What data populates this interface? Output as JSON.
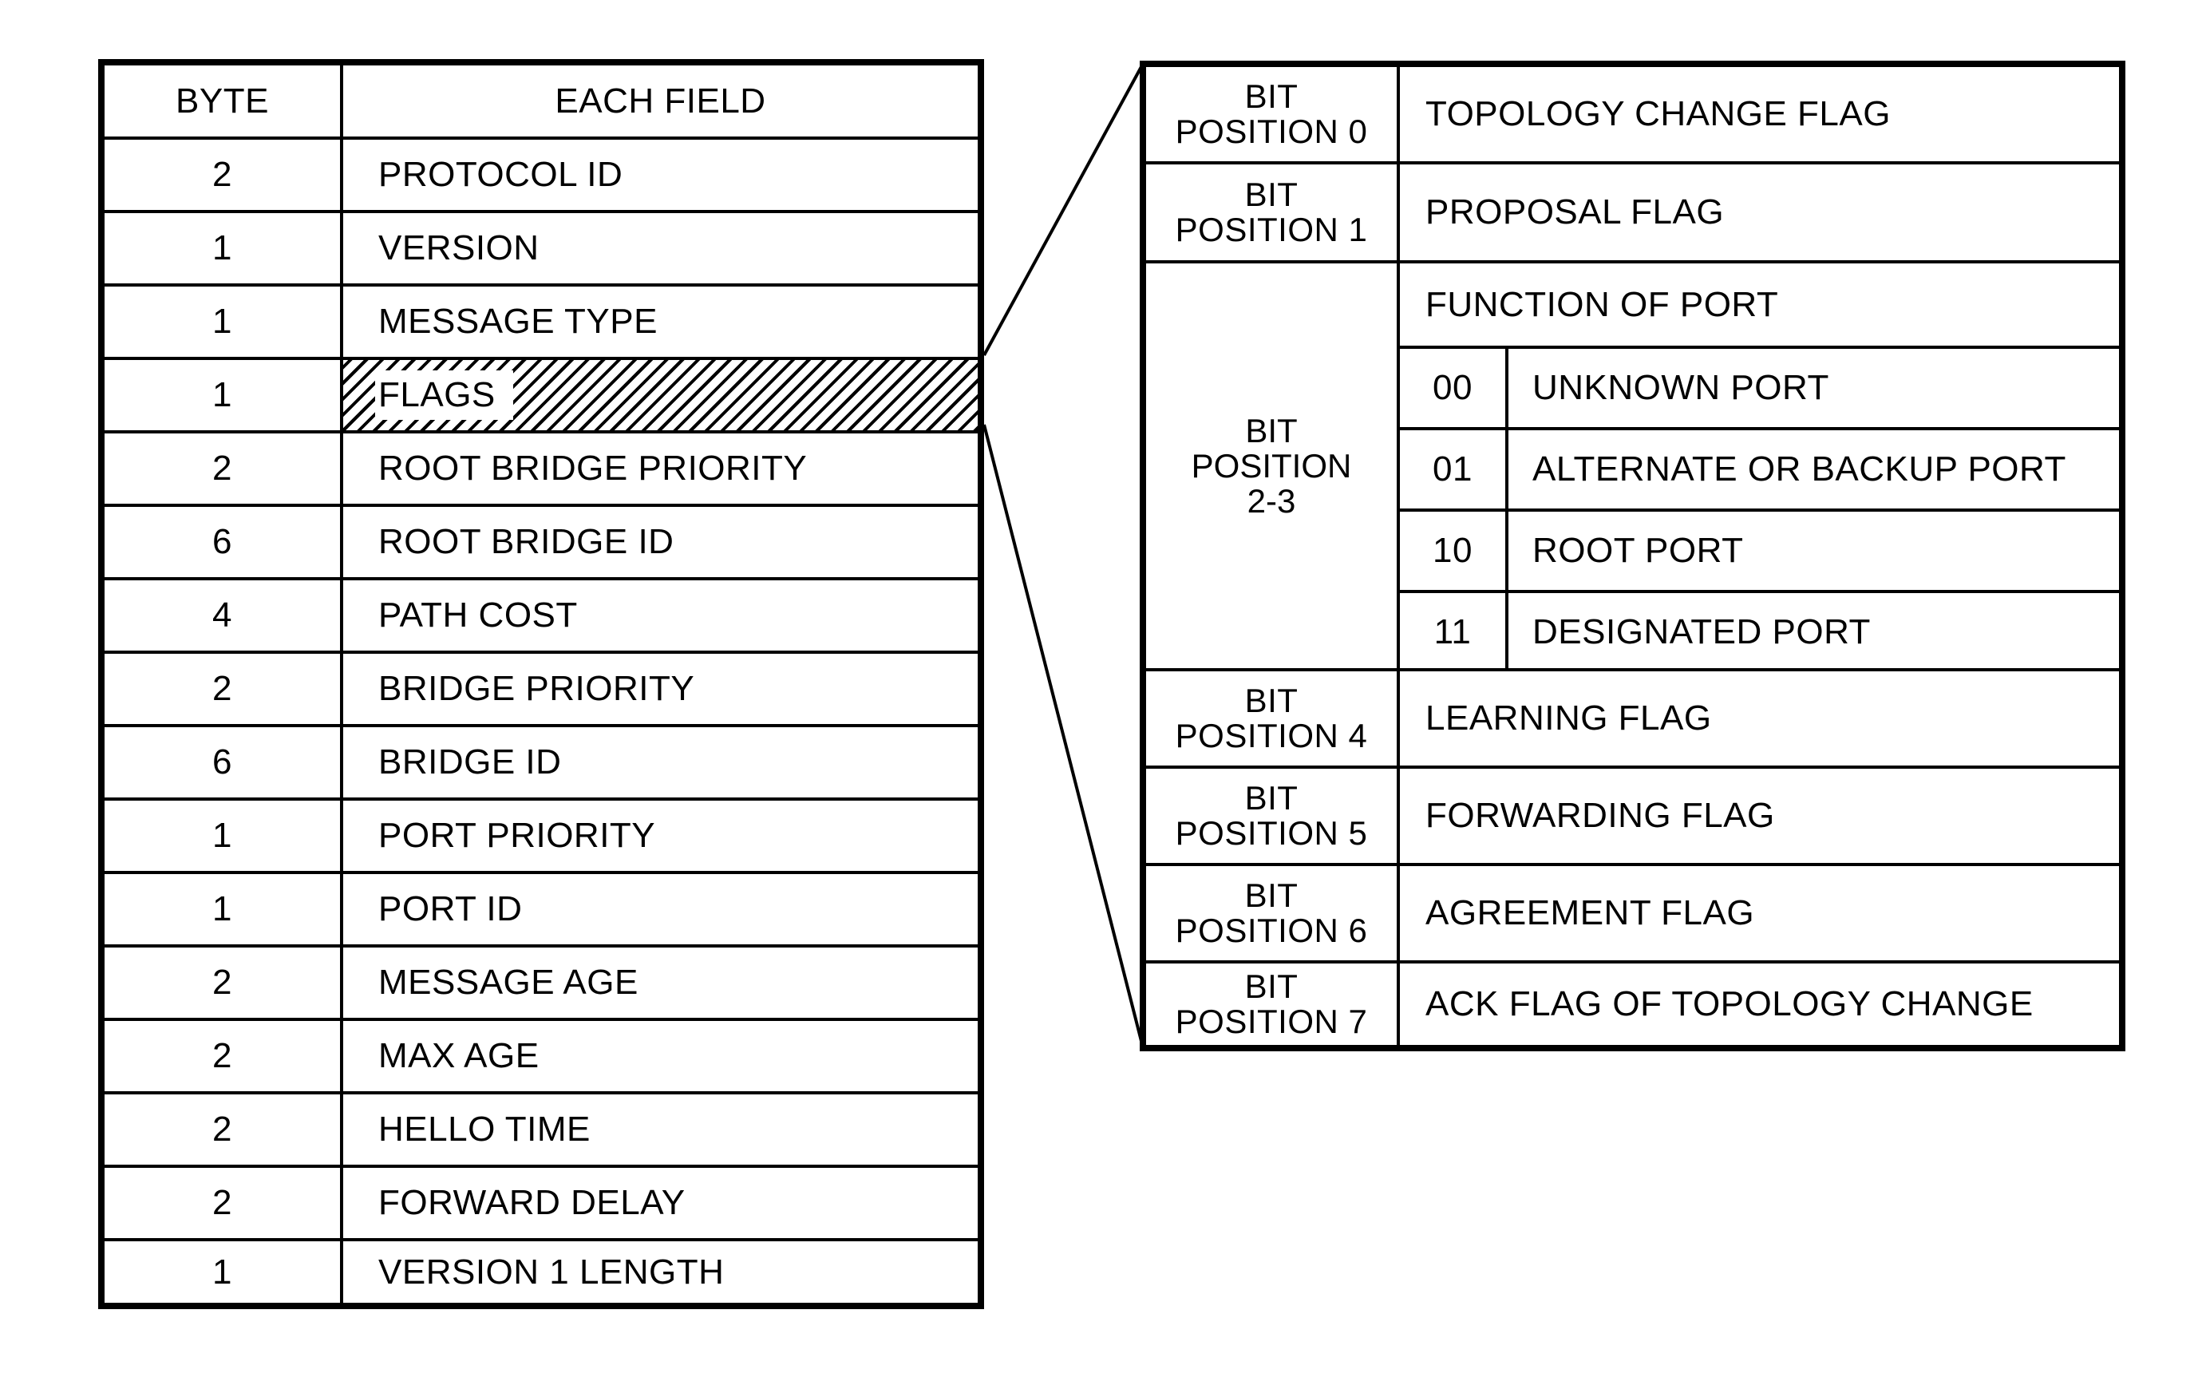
{
  "left_table": {
    "headers": {
      "byte": "BYTE",
      "field": "EACH FIELD"
    },
    "rows": [
      {
        "byte": "2",
        "field": "PROTOCOL ID"
      },
      {
        "byte": "1",
        "field": "VERSION"
      },
      {
        "byte": "1",
        "field": "MESSAGE TYPE"
      },
      {
        "byte": "1",
        "field": "FLAGS",
        "highlighted": true
      },
      {
        "byte": "2",
        "field": "ROOT BRIDGE PRIORITY"
      },
      {
        "byte": "6",
        "field": "ROOT BRIDGE ID"
      },
      {
        "byte": "4",
        "field": "PATH COST"
      },
      {
        "byte": "2",
        "field": "BRIDGE PRIORITY"
      },
      {
        "byte": "6",
        "field": "BRIDGE ID"
      },
      {
        "byte": "1",
        "field": "PORT PRIORITY"
      },
      {
        "byte": "1",
        "field": "PORT ID"
      },
      {
        "byte": "2",
        "field": "MESSAGE AGE"
      },
      {
        "byte": "2",
        "field": "MAX AGE"
      },
      {
        "byte": "2",
        "field": "HELLO TIME"
      },
      {
        "byte": "2",
        "field": "FORWARD DELAY"
      },
      {
        "byte": "1",
        "field": "VERSION 1 LENGTH"
      }
    ]
  },
  "right_table": {
    "bits": [
      {
        "line1": "BIT",
        "line2": "POSITION 0",
        "desc": "TOPOLOGY CHANGE FLAG"
      },
      {
        "line1": "BIT",
        "line2": "POSITION 1",
        "desc": "PROPOSAL FLAG"
      },
      {
        "line1": "BIT",
        "line2": "POSITION",
        "line3": "2-3",
        "desc": "FUNCTION OF PORT",
        "codes": [
          {
            "code": "00",
            "desc": "UNKNOWN PORT"
          },
          {
            "code": "01",
            "desc": "ALTERNATE OR BACKUP PORT"
          },
          {
            "code": "10",
            "desc": "ROOT PORT"
          },
          {
            "code": "11",
            "desc": "DESIGNATED PORT"
          }
        ]
      },
      {
        "line1": "BIT",
        "line2": "POSITION 4",
        "desc": "LEARNING FLAG"
      },
      {
        "line1": "BIT",
        "line2": "POSITION 5",
        "desc": "FORWARDING FLAG"
      },
      {
        "line1": "BIT",
        "line2": "POSITION 6",
        "desc": "AGREEMENT FLAG"
      },
      {
        "line1": "BIT",
        "line2": "POSITION 7",
        "desc": "ACK FLAG OF TOPOLOGY CHANGE"
      }
    ]
  }
}
